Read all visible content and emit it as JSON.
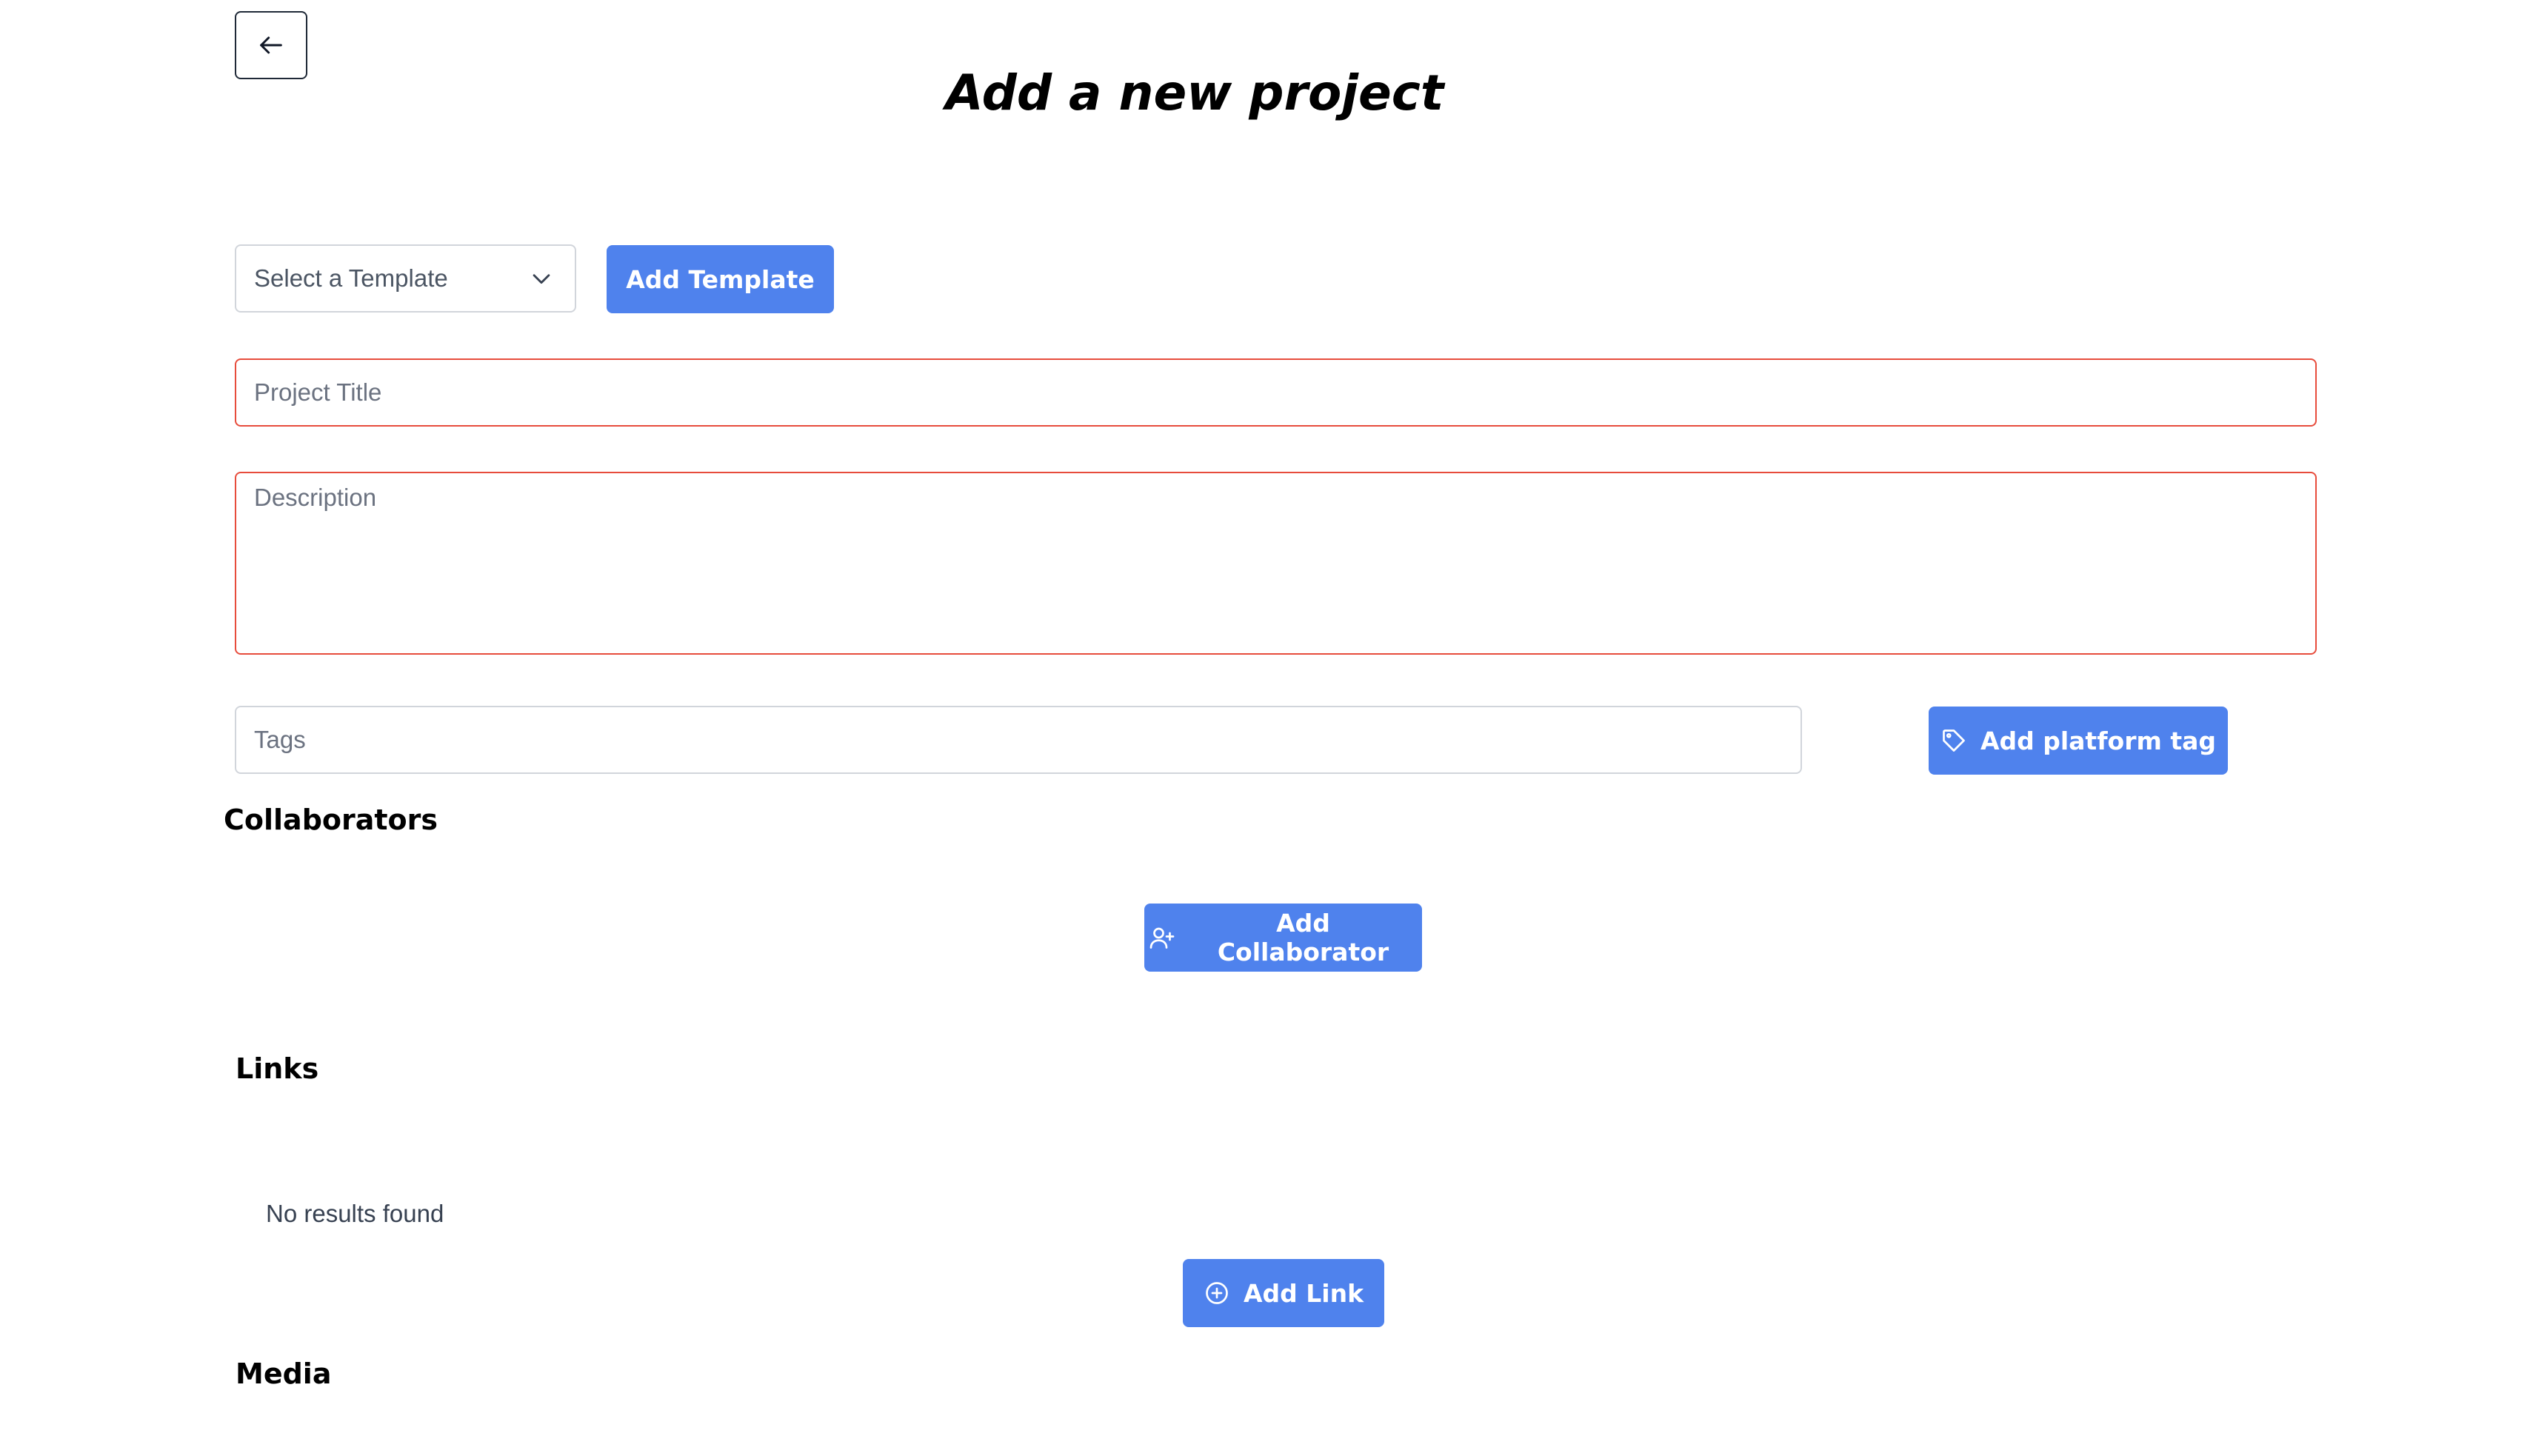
{
  "page": {
    "title": "Add a new project"
  },
  "template": {
    "select_placeholder": "Select a Template",
    "add_button": "Add Template"
  },
  "form": {
    "project_title_placeholder": "Project Title",
    "project_title_value": "",
    "description_placeholder": "Description",
    "description_value": "",
    "tags_placeholder": "Tags",
    "tags_value": "",
    "add_tag_button": "Add platform tag"
  },
  "collaborators": {
    "heading": "Collaborators",
    "add_button": "Add Collaborator"
  },
  "links": {
    "heading": "Links",
    "empty_message": "No results found",
    "add_button": "Add Link"
  },
  "media": {
    "heading": "Media"
  },
  "icons": {
    "back": "arrow-left-icon",
    "select": "chevron-down-icon",
    "tag": "tag-icon",
    "collaborator": "user-plus-icon",
    "link": "plus-circle-icon"
  },
  "colors": {
    "primary": "#4f82ed",
    "error_border": "#e74c3c",
    "neutral_border": "#d1d5db"
  }
}
